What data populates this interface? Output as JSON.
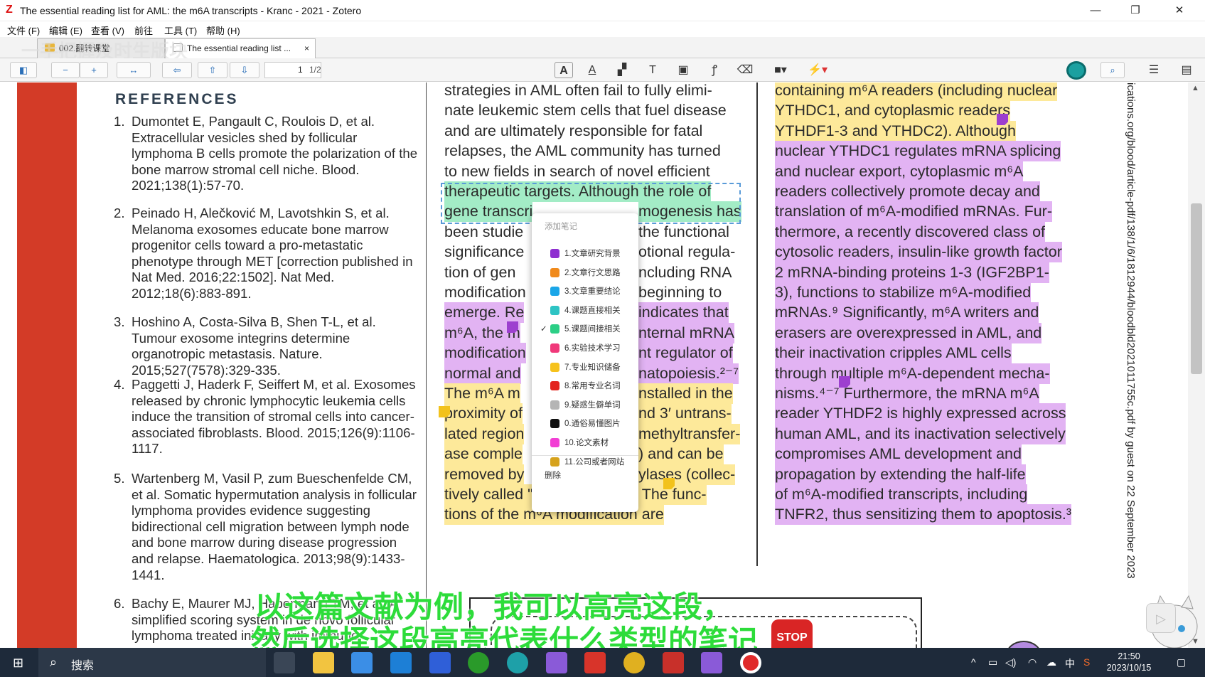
{
  "window": {
    "title": "The essential reading list for AML: the m6A transcripts - Kranc - 2021 - Zotero",
    "app_icon": "Z",
    "controls": {
      "minimize": "—",
      "restore": "❐",
      "close": "✕"
    }
  },
  "menu": [
    "文件 (F)",
    "编辑 (E)",
    "查看 (V)",
    "前往",
    "工具 (T)",
    "帮助 (H)"
  ],
  "tabs": [
    {
      "label": "002.翻转课堂",
      "active": false
    },
    {
      "label": "The essential reading list ...",
      "active": true,
      "close": "×"
    }
  ],
  "toolbar": {
    "page_current": "1",
    "page_total": "1/2"
  },
  "references": {
    "heading": "REFERENCES",
    "items": [
      {
        "num": "1.",
        "text": "Dumontet E, Pangault C, Roulois D, et al. Extracellular vesicles shed by follicular lymphoma B cells promote the polarization of the bone marrow stromal cell niche. Blood. 2021;138(1):57-70."
      },
      {
        "num": "2.",
        "text": "Peinado H, Alečković M, Lavotshkin S, et al. Melanoma exosomes educate bone marrow progenitor cells toward a pro-metastatic phenotype through MET [correction published in Nat Med. 2016;22:1502]. Nat Med. 2012;18(6):883-891."
      },
      {
        "num": "3.",
        "text": "Hoshino A, Costa-Silva B, Shen T-L, et al. Tumour exosome integrins determine organotropic metastasis. Nature. 2015;527(7578):329-335."
      },
      {
        "num": "4.",
        "text": "Paggetti J, Haderk F, Seiffert M, et al. Exosomes released by chronic lymphocytic leukemia cells induce the transition of stromal cells into cancer-associated fibroblasts. Blood. 2015;126(9):1106-1117."
      },
      {
        "num": "5.",
        "text": "Wartenberg M, Vasil P, zum Bueschenfelde CM, et al. Somatic hypermutation analysis in follicular lymphoma provides evidence suggesting bidirectional cell migration between lymph node and bone marrow during disease progression and relapse. Haematologica. 2013;98(9):1433-1441."
      },
      {
        "num": "6.",
        "text": "Bachy E, Maurer MJ, Habermann TM, et al. A simplified scoring system in de novo follicular lymphoma treated initially with immuno-"
      }
    ]
  },
  "middle_column": [
    "strategies in AML often fail to fully elimi-",
    "nate leukemic stem cells that fuel disease",
    "and are ultimately responsible for fatal",
    "relapses, the AML community has turned",
    "to new fields in search of novel efficient",
    "therapeutic targets. Although the role of",
    "gene transcri",
    "been studie",
    "significance",
    "tion of gen",
    "modification",
    "emerge. Re",
    "m⁶A, the m",
    "modification",
    "normal and",
    "The m⁶A m",
    "proximity of",
    "lated region",
    "ase comple",
    "removed by",
    "tively called \"m⁶A erasers\").⁸ The func-",
    "tions of the m⁶A modification are"
  ],
  "middle_right_fragments": [
    "mogenesis has",
    "the functional",
    "otional regula-",
    "ncluding RNA",
    "beginning to",
    "indicates that",
    "nternal mRNA",
    "nt regulator of",
    "natopoiesis.²⁻⁷",
    "nstalled in the",
    "nd 3′ untrans-",
    "methyltransfer-",
    ") and can be",
    "ylases (collec-"
  ],
  "right_column": [
    "containing m⁶A readers (including nuclear",
    "YTHDC1, and cytoplasmic readers",
    "YTHDF1-3 and YTHDC2). Although",
    "nuclear YTHDC1 regulates mRNA splicing",
    "and nuclear export, cytoplasmic m⁶A",
    "readers collectively promote decay and",
    "translation of m⁶A-modified mRNAs. Fur-",
    "thermore, a recently discovered class of",
    "cytosolic readers, insulin-like growth factor",
    "2 mRNA-binding proteins 1-3 (IGF2BP1-",
    "3), functions to stabilize m⁶A-modified",
    "mRNAs.⁹ Significantly, m⁶A writers and",
    "erasers are overexpressed in AML, and",
    "their inactivation cripples AML cells",
    "through multiple m⁶A-dependent mecha-",
    "nisms.⁴⁻⁷ Furthermore, the mRNA m⁶A",
    "reader YTHDF2 is highly expressed across",
    "human AML, and its inactivation selectively",
    "compromises AML development and",
    "propagation by extending the half-life",
    "of m⁶A-modified transcripts, including",
    "TNFR2, thus sensitizing them to apoptosis.³"
  ],
  "side_watermark": "ications.org/blood/article-pdf/138/1/6/1812944/bloodbld2021011755c.pdf by guest on 22 September 2023",
  "context_menu": {
    "header": "添加笔记",
    "items": [
      {
        "label": "1.文章研究背景",
        "color": "#8e2fd0",
        "checked": false
      },
      {
        "label": "2.文章行文思路",
        "color": "#f08a1c",
        "checked": false
      },
      {
        "label": "3.文章重要结论",
        "color": "#1aa6e8",
        "checked": false
      },
      {
        "label": "4.课题直接相关",
        "color": "#2ec4c4",
        "checked": false
      },
      {
        "label": "5.课题间接相关",
        "color": "#2ccf86",
        "checked": true
      },
      {
        "label": "6.实验技术学习",
        "color": "#f0397a",
        "checked": false
      },
      {
        "label": "7.专业知识储备",
        "color": "#f6c21c",
        "checked": false
      },
      {
        "label": "8.常用专业名词",
        "color": "#e3251f",
        "checked": false
      },
      {
        "label": "9.疑惑生僻单词",
        "color": "#b5b5b5",
        "checked": false
      },
      {
        "label": "0.通俗易懂图片",
        "color": "#111111",
        "checked": false
      },
      {
        "label": "10.论文素材",
        "color": "#f23fd4",
        "checked": false
      },
      {
        "label": "11.公司或者网站",
        "color": "#d6a21c",
        "checked": false
      }
    ],
    "delete_label": "删除",
    "check_mark": "✓"
  },
  "subtitles": {
    "line1": "以这篇文献为例，我可以高亮这段，",
    "line2": "然后选择这段高亮代表什么类型的笔记",
    "overlay_top": "一手把握及时生版块"
  },
  "figure": {
    "stop_label": "STOP"
  },
  "taskbar": {
    "search_label": "搜索",
    "time": "21:50",
    "date": "2023/10/15",
    "ime": "中"
  },
  "colors": {
    "highlight_yellow": "#fde99a",
    "highlight_purple": "#e2b3f3",
    "highlight_green": "#a3ecc6",
    "journal_red": "#d33b27",
    "subtitle_green": "#2ddc3a"
  }
}
